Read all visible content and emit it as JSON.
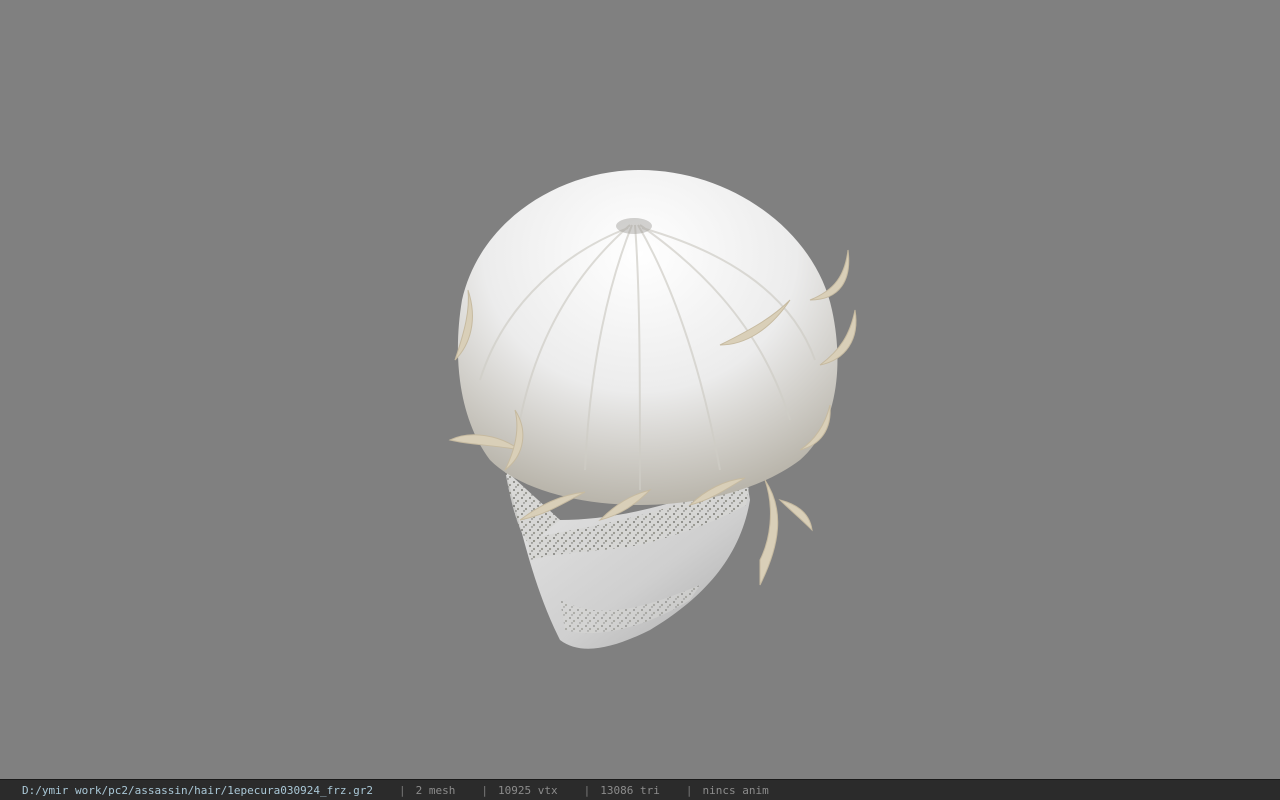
{
  "viewport": {
    "background_color": "#808080",
    "model": {
      "hair_color": "#f4f4f4",
      "hair_tip_color": "#d9cfb8",
      "mask_color": "#d8d8d8"
    }
  },
  "status": {
    "file_path": "D:/ymir work/pc2/assassin/hair/1epecura030924_frz.gr2",
    "separator": "|",
    "mesh_count": "2 mesh",
    "vertex_count": "10925 vtx",
    "triangle_count": "13086 tri",
    "anim": "nincs anim"
  }
}
